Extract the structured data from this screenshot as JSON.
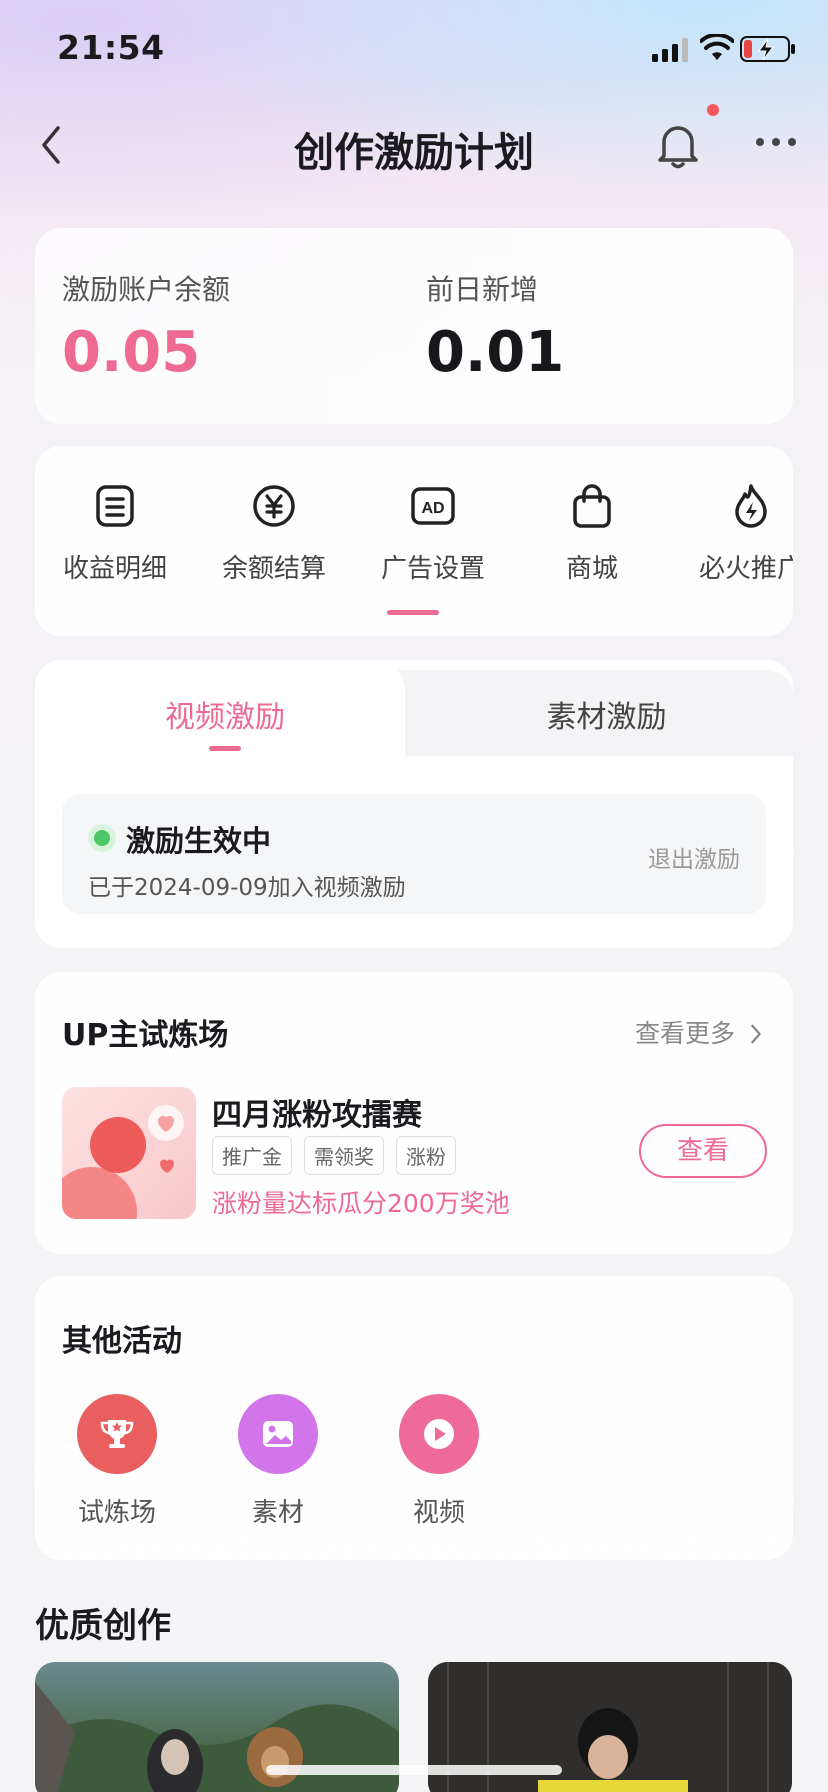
{
  "status_bar": {
    "time": "21:54"
  },
  "nav": {
    "title": "创作激励计划"
  },
  "balance": {
    "account_label": "激励账户余额",
    "account_value": "0.05",
    "new_label": "前日新增",
    "new_value": "0.01"
  },
  "shortcuts": [
    {
      "label": "收益明细",
      "icon": "list-doc-icon"
    },
    {
      "label": "余额结算",
      "icon": "yuan-icon"
    },
    {
      "label": "广告设置",
      "icon": "ad-icon"
    },
    {
      "label": "商城",
      "icon": "shopping-bag-icon"
    },
    {
      "label": "必火推广",
      "icon": "fire-bolt-icon"
    }
  ],
  "incentive": {
    "tabs": [
      "视频激励",
      "素材激励"
    ],
    "active_tab": "视频激励",
    "status_title": "激励生效中",
    "status_desc": "已于2024-09-09加入视频激励",
    "quit_label": "退出激励"
  },
  "trial": {
    "title": "UP主试炼场",
    "more_label": "查看更多",
    "event_name": "四月涨粉攻擂赛",
    "tags": [
      "推广金",
      "需领奖",
      "涨粉"
    ],
    "event_desc": "涨粉量达标瓜分200万奖池",
    "button_label": "查看"
  },
  "other": {
    "title": "其他活动",
    "items": [
      {
        "label": "试炼场",
        "icon": "trophy-icon",
        "color": "#e95e5e"
      },
      {
        "label": "素材",
        "icon": "image-icon",
        "color": "#d274ea"
      },
      {
        "label": "视频",
        "icon": "play-icon",
        "color": "#ee6a9a"
      }
    ]
  },
  "quality": {
    "title": "优质创作"
  },
  "colors": {
    "accent": "#ee6a92",
    "active_green": "#4cc766"
  }
}
